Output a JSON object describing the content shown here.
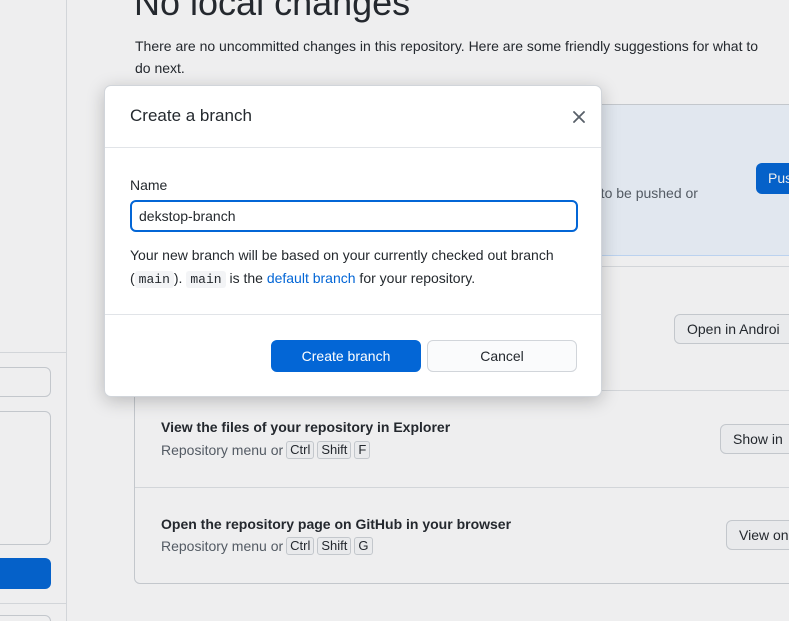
{
  "background": {
    "title": "No local changes",
    "description": "There are no uncommitted changes in this repository. Here are some friendly suggestions for what to do next.",
    "push_partial_text": "g to be pushed or",
    "push_button_label": "Pus",
    "open_editor_button_label": "Open in Androi",
    "explorer": {
      "title": "View the files of your repository in Explorer",
      "prefix": "Repository menu or",
      "keys": [
        "Ctrl",
        "Shift",
        "F"
      ],
      "button_label": "Show in"
    },
    "github": {
      "title": "Open the repository page on GitHub in your browser",
      "prefix": "Repository menu or",
      "keys": [
        "Ctrl",
        "Shift",
        "G"
      ],
      "button_label": "View on"
    }
  },
  "dialog": {
    "title": "Create a branch",
    "close_icon": "close-icon",
    "name_label": "Name",
    "name_value": "dekstop-branch",
    "info": {
      "part1": "Your new branch will be based on your currently checked out branch (",
      "branch": "main",
      "part2": "). ",
      "default_branch": "main",
      "part3": " is the ",
      "link": "default branch",
      "part4": " for your repository."
    },
    "create_button": "Create branch",
    "cancel_button": "Cancel"
  },
  "colors": {
    "accent": "#0366d6",
    "border": "#d1d5da",
    "text": "#24292e",
    "muted": "#586069"
  }
}
